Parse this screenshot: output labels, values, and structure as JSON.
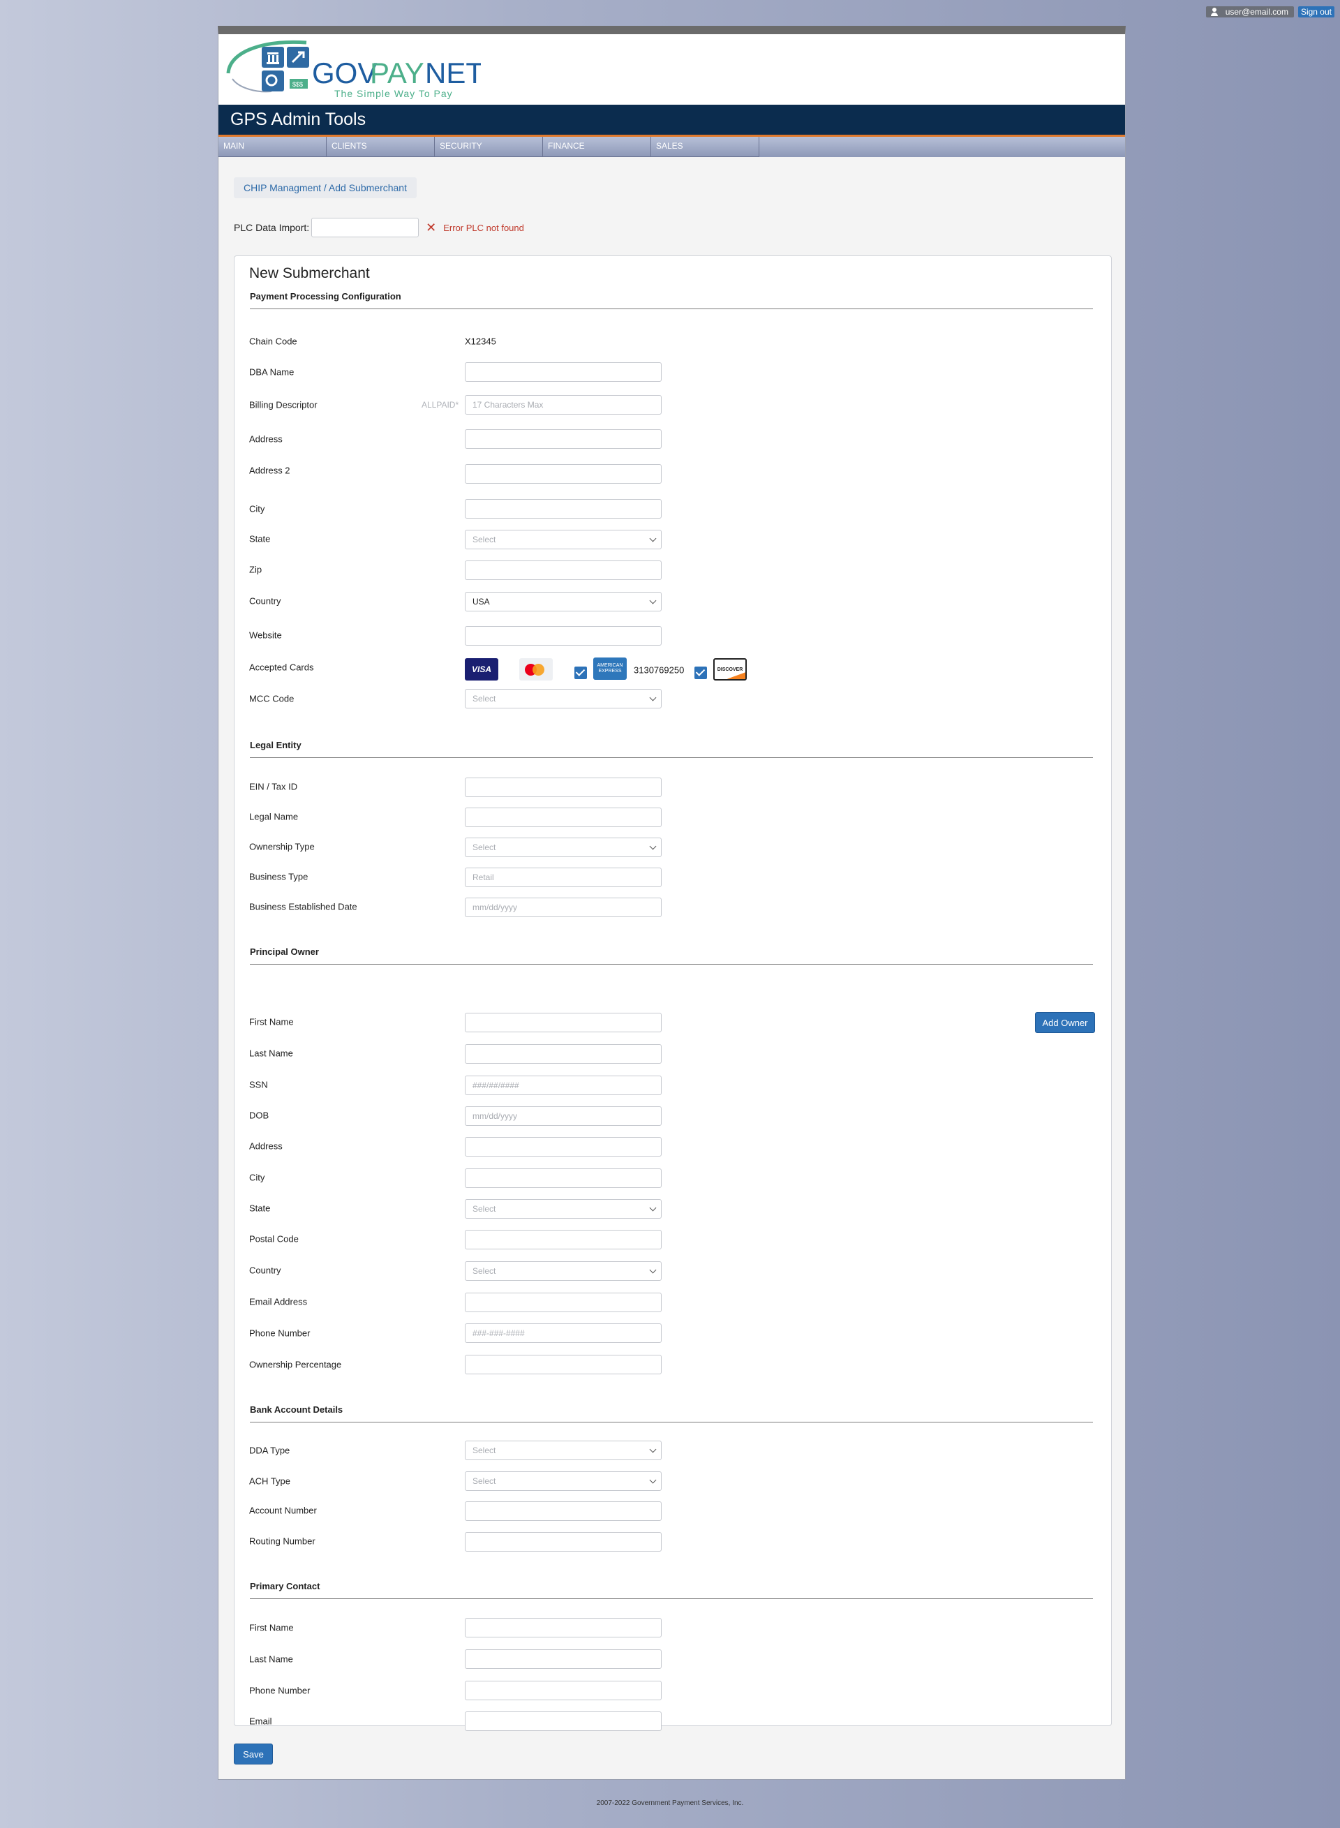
{
  "topbar": {
    "user_email": "user@email.com",
    "signout_label": "Sign out"
  },
  "brand": {
    "name_part1": "GOV",
    "name_part2": "PAY",
    "name_part3": "NET",
    "tagline": "The Simple Way To Pay"
  },
  "header": {
    "title": "GPS Admin Tools"
  },
  "nav": {
    "items": [
      "MAIN",
      "CLIENTS",
      "SECURITY",
      "FINANCE",
      "SALES"
    ]
  },
  "breadcrumb": "CHIP Managment /  Add Submerchant",
  "plc": {
    "label": "PLC Data Import:",
    "error": "Error PLC not found"
  },
  "form": {
    "title": "New Submerchant",
    "sections": {
      "payment": "Payment Processing Configuration",
      "legal": "Legal Entity",
      "owner": "Principal Owner",
      "bank": "Bank Account Details",
      "contact": "Primary Contact"
    },
    "payment": {
      "chain_code_label": "Chain Code",
      "chain_code_value": "X12345",
      "dba_label": "DBA Name",
      "billing_label": "Billing Descriptor",
      "billing_prefix": "ALLPAID*",
      "billing_placeholder": "17 Characters Max",
      "address_label": "Address",
      "address2_label": "Address 2",
      "city_label": "City",
      "state_label": "State",
      "state_value": "Select",
      "zip_label": "Zip",
      "country_label": "Country",
      "country_value": "USA",
      "website_label": "Website",
      "cards_label": "Accepted Cards",
      "visa_text": "VISA",
      "amex_text": "AMERICAN EXPRESS",
      "amex_number": "3130769250",
      "discover_text": "DISCOVER",
      "mcc_label": "MCC Code",
      "mcc_value": "Select"
    },
    "legal": {
      "ein_label": "EIN / Tax ID",
      "legal_name_label": "Legal Name",
      "ownership_label": "Ownership Type",
      "ownership_value": "Select",
      "business_type_label": "Business Type",
      "business_type_placeholder": "Retail",
      "established_label": "Business Established Date",
      "established_placeholder": "mm/dd/yyyy"
    },
    "owner": {
      "add_owner_label": "Add Owner",
      "first_name_label": "First Name",
      "last_name_label": "Last Name",
      "ssn_label": "SSN",
      "ssn_placeholder": "###/##/####",
      "dob_label": "DOB",
      "dob_placeholder": "mm/dd/yyyy",
      "address_label": "Address",
      "city_label": "City",
      "state_label": "State",
      "state_value": "Select",
      "postal_label": "Postal Code",
      "country_label": "Country",
      "country_value": "Select",
      "email_label": "Email Address",
      "phone_label": "Phone Number",
      "phone_placeholder": "###-###-####",
      "ownership_pct_label": "Ownership Percentage"
    },
    "bank": {
      "dda_label": "DDA Type",
      "dda_value": "Select",
      "ach_label": "ACH Type",
      "ach_value": "Select",
      "account_label": "Account Number",
      "routing_label": "Routing Number"
    },
    "contact": {
      "first_name_label": "First Name",
      "last_name_label": "Last Name",
      "phone_label": "Phone Number",
      "email_label": "Email"
    },
    "save_label": "Save"
  },
  "footer": "2007-2022 Government Payment Services, Inc."
}
